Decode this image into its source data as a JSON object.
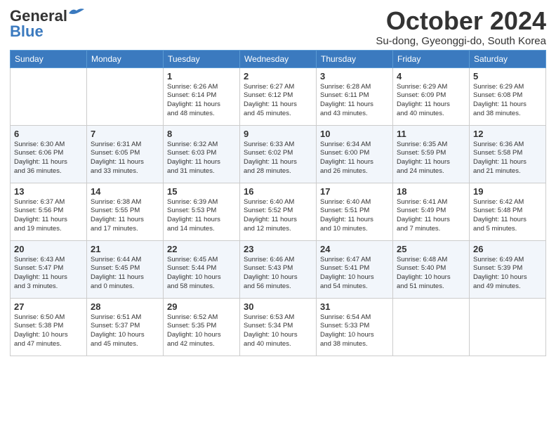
{
  "logo": {
    "line1": "General",
    "line2": "Blue"
  },
  "title": "October 2024",
  "subtitle": "Su-dong, Gyeonggi-do, South Korea",
  "weekdays": [
    "Sunday",
    "Monday",
    "Tuesday",
    "Wednesday",
    "Thursday",
    "Friday",
    "Saturday"
  ],
  "weeks": [
    [
      {
        "day": "",
        "info": ""
      },
      {
        "day": "",
        "info": ""
      },
      {
        "day": "1",
        "info": "Sunrise: 6:26 AM\nSunset: 6:14 PM\nDaylight: 11 hours\nand 48 minutes."
      },
      {
        "day": "2",
        "info": "Sunrise: 6:27 AM\nSunset: 6:12 PM\nDaylight: 11 hours\nand 45 minutes."
      },
      {
        "day": "3",
        "info": "Sunrise: 6:28 AM\nSunset: 6:11 PM\nDaylight: 11 hours\nand 43 minutes."
      },
      {
        "day": "4",
        "info": "Sunrise: 6:29 AM\nSunset: 6:09 PM\nDaylight: 11 hours\nand 40 minutes."
      },
      {
        "day": "5",
        "info": "Sunrise: 6:29 AM\nSunset: 6:08 PM\nDaylight: 11 hours\nand 38 minutes."
      }
    ],
    [
      {
        "day": "6",
        "info": "Sunrise: 6:30 AM\nSunset: 6:06 PM\nDaylight: 11 hours\nand 36 minutes."
      },
      {
        "day": "7",
        "info": "Sunrise: 6:31 AM\nSunset: 6:05 PM\nDaylight: 11 hours\nand 33 minutes."
      },
      {
        "day": "8",
        "info": "Sunrise: 6:32 AM\nSunset: 6:03 PM\nDaylight: 11 hours\nand 31 minutes."
      },
      {
        "day": "9",
        "info": "Sunrise: 6:33 AM\nSunset: 6:02 PM\nDaylight: 11 hours\nand 28 minutes."
      },
      {
        "day": "10",
        "info": "Sunrise: 6:34 AM\nSunset: 6:00 PM\nDaylight: 11 hours\nand 26 minutes."
      },
      {
        "day": "11",
        "info": "Sunrise: 6:35 AM\nSunset: 5:59 PM\nDaylight: 11 hours\nand 24 minutes."
      },
      {
        "day": "12",
        "info": "Sunrise: 6:36 AM\nSunset: 5:58 PM\nDaylight: 11 hours\nand 21 minutes."
      }
    ],
    [
      {
        "day": "13",
        "info": "Sunrise: 6:37 AM\nSunset: 5:56 PM\nDaylight: 11 hours\nand 19 minutes."
      },
      {
        "day": "14",
        "info": "Sunrise: 6:38 AM\nSunset: 5:55 PM\nDaylight: 11 hours\nand 17 minutes."
      },
      {
        "day": "15",
        "info": "Sunrise: 6:39 AM\nSunset: 5:53 PM\nDaylight: 11 hours\nand 14 minutes."
      },
      {
        "day": "16",
        "info": "Sunrise: 6:40 AM\nSunset: 5:52 PM\nDaylight: 11 hours\nand 12 minutes."
      },
      {
        "day": "17",
        "info": "Sunrise: 6:40 AM\nSunset: 5:51 PM\nDaylight: 11 hours\nand 10 minutes."
      },
      {
        "day": "18",
        "info": "Sunrise: 6:41 AM\nSunset: 5:49 PM\nDaylight: 11 hours\nand 7 minutes."
      },
      {
        "day": "19",
        "info": "Sunrise: 6:42 AM\nSunset: 5:48 PM\nDaylight: 11 hours\nand 5 minutes."
      }
    ],
    [
      {
        "day": "20",
        "info": "Sunrise: 6:43 AM\nSunset: 5:47 PM\nDaylight: 11 hours\nand 3 minutes."
      },
      {
        "day": "21",
        "info": "Sunrise: 6:44 AM\nSunset: 5:45 PM\nDaylight: 11 hours\nand 0 minutes."
      },
      {
        "day": "22",
        "info": "Sunrise: 6:45 AM\nSunset: 5:44 PM\nDaylight: 10 hours\nand 58 minutes."
      },
      {
        "day": "23",
        "info": "Sunrise: 6:46 AM\nSunset: 5:43 PM\nDaylight: 10 hours\nand 56 minutes."
      },
      {
        "day": "24",
        "info": "Sunrise: 6:47 AM\nSunset: 5:41 PM\nDaylight: 10 hours\nand 54 minutes."
      },
      {
        "day": "25",
        "info": "Sunrise: 6:48 AM\nSunset: 5:40 PM\nDaylight: 10 hours\nand 51 minutes."
      },
      {
        "day": "26",
        "info": "Sunrise: 6:49 AM\nSunset: 5:39 PM\nDaylight: 10 hours\nand 49 minutes."
      }
    ],
    [
      {
        "day": "27",
        "info": "Sunrise: 6:50 AM\nSunset: 5:38 PM\nDaylight: 10 hours\nand 47 minutes."
      },
      {
        "day": "28",
        "info": "Sunrise: 6:51 AM\nSunset: 5:37 PM\nDaylight: 10 hours\nand 45 minutes."
      },
      {
        "day": "29",
        "info": "Sunrise: 6:52 AM\nSunset: 5:35 PM\nDaylight: 10 hours\nand 42 minutes."
      },
      {
        "day": "30",
        "info": "Sunrise: 6:53 AM\nSunset: 5:34 PM\nDaylight: 10 hours\nand 40 minutes."
      },
      {
        "day": "31",
        "info": "Sunrise: 6:54 AM\nSunset: 5:33 PM\nDaylight: 10 hours\nand 38 minutes."
      },
      {
        "day": "",
        "info": ""
      },
      {
        "day": "",
        "info": ""
      }
    ]
  ]
}
